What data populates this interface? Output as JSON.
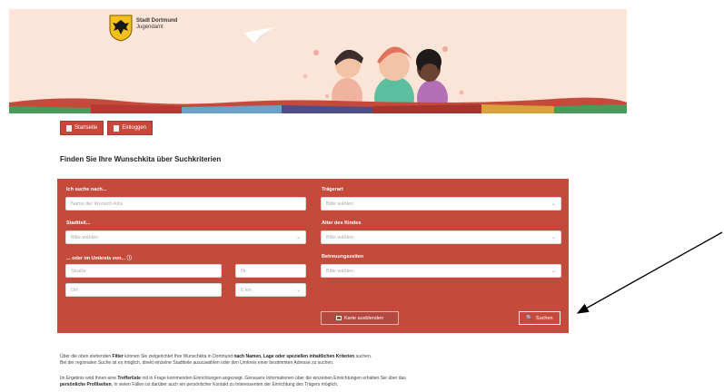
{
  "banner": {
    "logo_title": "Stadt Dortmund",
    "logo_subtitle": "Jugendamt"
  },
  "top_buttons": [
    {
      "label": "Startseite"
    },
    {
      "label": "Einloggen"
    }
  ],
  "heading": "Finden Sie Ihre Wunschkita über Suchkriterien",
  "form": {
    "search_label": "Ich suche nach...",
    "search_placeholder": "Name der Wunsch-Kita",
    "traeger_label": "Trägerart",
    "traeger_placeholder": "Bitte wählen",
    "stadtteil_label": "Stadtteil...",
    "stadtteil_placeholder": "Bitte wählen",
    "alter_label": "Alter des Kindes",
    "alter_placeholder": "Bitte wählen",
    "umkreis_label": "... oder im Umkreis von... ⓘ",
    "strasse_placeholder": "Straße",
    "nr_placeholder": "Nr.",
    "plz_placeholder": "Ort",
    "km_value": "5 km",
    "betreuung_label": "Betreuungszeiten",
    "betreuung_placeholder": "Bitte wählen",
    "map_button": "Karte ausblenden",
    "search_button": "Suchen"
  },
  "intro": {
    "p1_a": "Über die oben stehenden ",
    "p1_b": "Filter",
    "p1_c": " können Sie zielgerichtet Ihre Wunschkita in Dortmund ",
    "p1_d": "nach Namen, Lage oder speziellen inhaltlichen Kriterien",
    "p1_e": " suchen.",
    "p1_line2": "Bei der regionalen Suche ist es möglich, direkt einzelne Stadtteile auszuwählen oder den Umkreis einer bestimmten Adresse zu suchen.",
    "p2_a": "Im Ergebnis wird Ihnen eine ",
    "p2_b": "Trefferliste",
    "p2_c": " mit in Frage kommenden Einrichtungen angezeigt. Genauere Informationen über die einzelnen Einrichtungen erhalten Sie über das",
    "p2_line2_a": "persönliche Profilseiten",
    "p2_line2_b": ", in vielen Fällen ist darüber auch ein persönlicher Kontakt zu Interessenten der Einrichtung des Trägers möglich."
  },
  "colors": {
    "accent": "#c44a3c",
    "banner_bg": "#fbe5d8"
  }
}
